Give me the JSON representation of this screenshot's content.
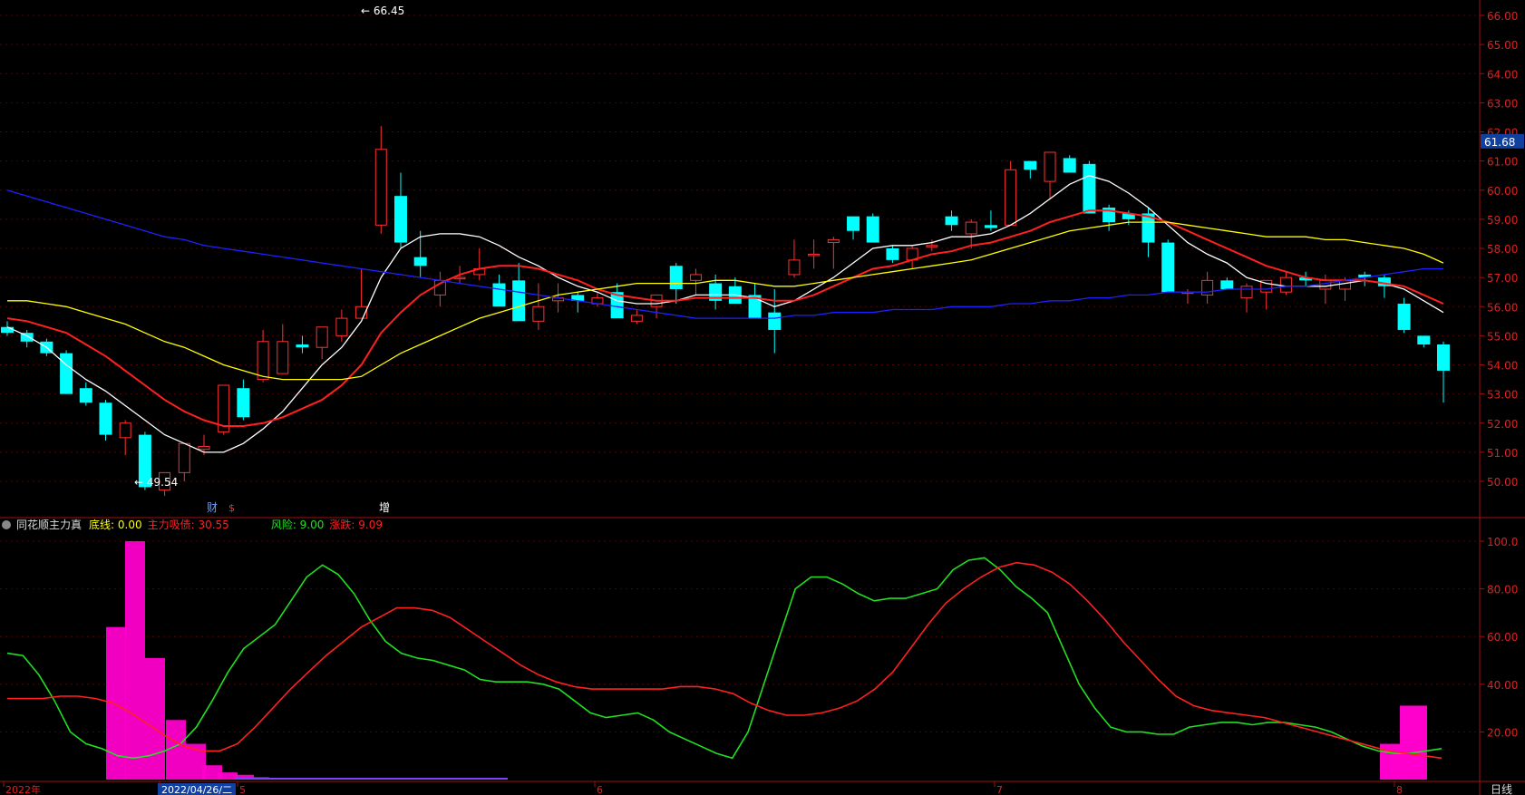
{
  "indicator": {
    "name": "同花顺主力真",
    "items": [
      {
        "label": "底线:",
        "value": "0.00",
        "color": "#ffff00"
      },
      {
        "label": "主力吸债:",
        "value": "30.55",
        "color": "#ff2020"
      },
      {
        "label": "风险:",
        "value": "9.00",
        "color": "#20e020"
      },
      {
        "label": "涨跌:",
        "value": "9.09",
        "color": "#ff2020"
      }
    ]
  },
  "price_axis": {
    "ticks": [
      "66.00",
      "65.00",
      "64.00",
      "63.00",
      "62.00",
      "61.00",
      "60.00",
      "59.00",
      "58.00",
      "57.00",
      "56.00",
      "55.00",
      "54.00",
      "53.00",
      "52.00",
      "51.00",
      "50.00"
    ],
    "current": "61.68"
  },
  "ind_axis": {
    "ticks": [
      "100.0",
      "80.00",
      "60.00",
      "40.00",
      "20.00"
    ]
  },
  "bottom_axis": {
    "labels": [
      "2022年",
      "2022/04/26/二",
      "5",
      "6",
      "7",
      "8"
    ],
    "period": "日线"
  },
  "annotations": {
    "high": "66.45",
    "low": "49.54",
    "marker1": "财",
    "marker2": "$",
    "marker3": "增"
  },
  "colors": {
    "up": "#ff3030",
    "down": "#00ffff",
    "ma5": "#ffffff",
    "ma10": "#ff2020",
    "ma20": "#ffff00",
    "ma60": "#2020ff",
    "green": "#20e020",
    "pink": "#ff00cc"
  },
  "chart_data": {
    "type": "candlestick",
    "candles": [
      [
        55.3,
        55.5,
        55.0,
        55.1
      ],
      [
        55.1,
        55.2,
        54.6,
        54.8
      ],
      [
        54.8,
        54.9,
        54.3,
        54.4
      ],
      [
        54.4,
        54.5,
        53.0,
        53.0
      ],
      [
        53.2,
        53.4,
        52.6,
        52.7
      ],
      [
        52.7,
        52.8,
        51.4,
        51.6
      ],
      [
        51.5,
        52.1,
        50.9,
        52.0
      ],
      [
        51.6,
        51.7,
        49.7,
        49.8
      ],
      [
        49.7,
        50.3,
        49.5,
        50.3
      ],
      [
        50.3,
        51.3,
        50.0,
        51.3
      ],
      [
        51.1,
        51.6,
        50.9,
        51.2
      ],
      [
        51.7,
        53.3,
        51.6,
        53.3
      ],
      [
        53.2,
        53.5,
        52.1,
        52.2
      ],
      [
        53.5,
        55.2,
        53.4,
        54.8
      ],
      [
        53.7,
        55.4,
        53.7,
        54.8
      ],
      [
        54.7,
        55.0,
        54.4,
        54.6
      ],
      [
        54.6,
        55.3,
        54.2,
        55.3
      ],
      [
        55.0,
        55.9,
        54.8,
        55.6
      ],
      [
        55.6,
        57.3,
        55.6,
        56.0
      ],
      [
        58.8,
        62.2,
        58.5,
        61.4
      ],
      [
        59.8,
        60.6,
        58.0,
        58.2
      ],
      [
        57.7,
        58.6,
        57.0,
        57.4
      ],
      [
        56.4,
        57.2,
        56.0,
        56.9
      ],
      [
        57.0,
        57.4,
        56.8,
        57.0
      ],
      [
        57.1,
        58.0,
        56.9,
        57.3
      ],
      [
        56.8,
        57.1,
        56.1,
        56.0
      ],
      [
        56.9,
        57.5,
        56.0,
        55.5
      ],
      [
        55.5,
        56.8,
        55.2,
        56.0
      ],
      [
        56.2,
        56.8,
        55.8,
        56.3
      ],
      [
        56.4,
        56.5,
        55.8,
        56.2
      ],
      [
        56.1,
        56.5,
        56.0,
        56.3
      ],
      [
        56.5,
        56.8,
        55.8,
        55.6
      ],
      [
        55.5,
        55.9,
        55.4,
        55.7
      ],
      [
        56.0,
        56.4,
        55.6,
        56.4
      ],
      [
        57.4,
        57.5,
        56.1,
        56.6
      ],
      [
        56.9,
        57.3,
        56.4,
        57.1
      ],
      [
        56.8,
        57.1,
        55.9,
        56.2
      ],
      [
        56.7,
        57.0,
        56.1,
        56.1
      ],
      [
        56.4,
        56.8,
        56.0,
        55.6
      ],
      [
        55.8,
        56.6,
        54.4,
        55.2
      ],
      [
        57.1,
        58.3,
        57.0,
        57.6
      ],
      [
        57.8,
        58.3,
        57.3,
        57.8
      ],
      [
        58.2,
        58.4,
        57.3,
        58.3
      ],
      [
        59.1,
        59.1,
        58.3,
        58.6
      ],
      [
        59.1,
        59.2,
        58.3,
        58.2
      ],
      [
        58.0,
        58.1,
        57.5,
        57.6
      ],
      [
        57.6,
        58.1,
        57.3,
        58.0
      ],
      [
        58.1,
        58.3,
        57.9,
        58.1
      ],
      [
        59.1,
        59.3,
        58.6,
        58.8
      ],
      [
        58.5,
        59.0,
        58.0,
        58.9
      ],
      [
        58.8,
        59.3,
        58.6,
        58.7
      ],
      [
        58.8,
        61.0,
        58.8,
        60.7
      ],
      [
        61.0,
        61.0,
        60.4,
        60.7
      ],
      [
        60.3,
        61.2,
        59.7,
        61.3
      ],
      [
        61.1,
        61.2,
        60.8,
        60.6
      ],
      [
        60.9,
        61.0,
        59.5,
        59.2
      ],
      [
        59.4,
        59.5,
        58.6,
        58.9
      ],
      [
        59.2,
        59.3,
        58.8,
        59.0
      ],
      [
        59.2,
        59.4,
        57.7,
        58.2
      ],
      [
        58.2,
        58.3,
        56.6,
        56.5
      ],
      [
        56.5,
        56.6,
        56.1,
        56.5
      ],
      [
        56.4,
        57.2,
        56.1,
        56.9
      ],
      [
        56.9,
        57.0,
        56.6,
        56.6
      ],
      [
        56.3,
        56.8,
        55.8,
        56.7
      ],
      [
        56.5,
        56.8,
        55.9,
        56.9
      ],
      [
        56.5,
        57.2,
        56.4,
        57.0
      ],
      [
        57.0,
        57.2,
        56.7,
        56.9
      ],
      [
        56.6,
        57.1,
        56.1,
        56.9
      ],
      [
        56.6,
        57.0,
        56.2,
        56.9
      ],
      [
        57.1,
        57.2,
        56.7,
        57.0
      ],
      [
        57.0,
        57.1,
        56.3,
        56.7
      ],
      [
        56.1,
        56.3,
        55.1,
        55.2
      ],
      [
        55.0,
        55.0,
        54.6,
        54.7
      ],
      [
        54.7,
        54.8,
        52.7,
        53.8
      ]
    ],
    "ma_series": [
      {
        "values": [
          55.3,
          55.0,
          54.6,
          54.0,
          53.5,
          53.1,
          52.6,
          52.1,
          51.6,
          51.3,
          51.0,
          51.0,
          51.3,
          51.8,
          52.4,
          53.2,
          54.0,
          54.6,
          55.5,
          57.0,
          58.0,
          58.4,
          58.5,
          58.5,
          58.4,
          58.1,
          57.7,
          57.4,
          57.0,
          56.7,
          56.5,
          56.2,
          56.1,
          56.1,
          56.2,
          56.4,
          56.4,
          56.4,
          56.3,
          56.0,
          56.2,
          56.6,
          57.0,
          57.5,
          58.0,
          58.1,
          58.1,
          58.2,
          58.4,
          58.4,
          58.5,
          58.8,
          59.2,
          59.7,
          60.2,
          60.5,
          60.3,
          59.9,
          59.4,
          58.8,
          58.2,
          57.8,
          57.5,
          57.0,
          56.8,
          56.7,
          56.7,
          56.7,
          56.8,
          56.9,
          56.8,
          56.6,
          56.2,
          55.8
        ]
      },
      {
        "values": [
          55.6,
          55.5,
          55.3,
          55.1,
          54.7,
          54.3,
          53.8,
          53.3,
          52.8,
          52.4,
          52.1,
          51.9,
          51.9,
          52.0,
          52.2,
          52.5,
          52.8,
          53.3,
          54.0,
          55.1,
          55.8,
          56.4,
          56.8,
          57.1,
          57.3,
          57.4,
          57.4,
          57.3,
          57.1,
          56.9,
          56.6,
          56.4,
          56.3,
          56.2,
          56.2,
          56.3,
          56.3,
          56.3,
          56.3,
          56.2,
          56.2,
          56.4,
          56.7,
          57.0,
          57.3,
          57.4,
          57.6,
          57.8,
          57.9,
          58.1,
          58.2,
          58.4,
          58.6,
          58.9,
          59.1,
          59.3,
          59.3,
          59.2,
          59.1,
          58.9,
          58.6,
          58.3,
          58.0,
          57.7,
          57.4,
          57.2,
          57.0,
          56.9,
          56.9,
          56.9,
          56.8,
          56.7,
          56.4,
          56.1
        ]
      },
      {
        "values": [
          56.2,
          56.2,
          56.1,
          56.0,
          55.8,
          55.6,
          55.4,
          55.1,
          54.8,
          54.6,
          54.3,
          54.0,
          53.8,
          53.6,
          53.5,
          53.5,
          53.5,
          53.5,
          53.6,
          54.0,
          54.4,
          54.7,
          55.0,
          55.3,
          55.6,
          55.8,
          56.0,
          56.2,
          56.4,
          56.5,
          56.6,
          56.7,
          56.8,
          56.8,
          56.8,
          56.8,
          56.9,
          56.9,
          56.8,
          56.7,
          56.7,
          56.8,
          56.9,
          57.0,
          57.1,
          57.2,
          57.3,
          57.4,
          57.5,
          57.6,
          57.8,
          58.0,
          58.2,
          58.4,
          58.6,
          58.7,
          58.8,
          58.9,
          58.9,
          58.9,
          58.8,
          58.7,
          58.6,
          58.5,
          58.4,
          58.4,
          58.4,
          58.3,
          58.3,
          58.2,
          58.1,
          58.0,
          57.8,
          57.5
        ]
      },
      {
        "values": [
          60.0,
          59.8,
          59.6,
          59.4,
          59.2,
          59.0,
          58.8,
          58.6,
          58.4,
          58.3,
          58.1,
          58.0,
          57.9,
          57.8,
          57.7,
          57.6,
          57.5,
          57.4,
          57.3,
          57.2,
          57.1,
          57.0,
          56.9,
          56.8,
          56.7,
          56.6,
          56.5,
          56.4,
          56.3,
          56.2,
          56.1,
          56.0,
          55.9,
          55.8,
          55.7,
          55.6,
          55.6,
          55.6,
          55.6,
          55.6,
          55.7,
          55.7,
          55.8,
          55.8,
          55.8,
          55.9,
          55.9,
          55.9,
          56.0,
          56.0,
          56.0,
          56.1,
          56.1,
          56.2,
          56.2,
          56.3,
          56.3,
          56.4,
          56.4,
          56.5,
          56.5,
          56.5,
          56.6,
          56.6,
          56.6,
          56.7,
          56.7,
          56.8,
          56.9,
          57.0,
          57.1,
          57.2,
          57.3,
          57.3
        ]
      }
    ],
    "indicator_green": [
      53,
      52,
      44,
      33,
      20,
      15,
      13,
      10,
      9,
      10,
      12,
      15,
      22,
      33,
      45,
      55,
      60,
      65,
      75,
      85,
      90,
      86,
      78,
      67,
      58,
      53,
      51,
      50,
      48,
      46,
      42,
      41,
      41,
      41,
      40,
      38,
      33,
      28,
      26,
      27,
      28,
      25,
      20,
      17,
      14,
      11,
      9,
      20,
      40,
      60,
      80,
      85,
      85,
      82,
      78,
      75,
      76,
      76,
      78,
      80,
      88,
      92,
      93,
      88,
      81,
      76,
      70,
      55,
      40,
      30,
      22,
      20,
      20,
      19,
      19,
      22,
      23,
      24,
      24,
      23,
      24,
      24,
      23,
      22,
      20,
      17,
      14,
      12,
      11,
      11,
      12,
      13
    ]
  }
}
